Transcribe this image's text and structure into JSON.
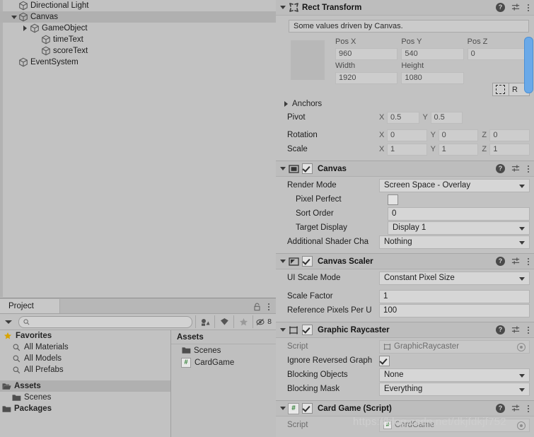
{
  "hierarchy": {
    "rows": [
      {
        "label": "Directional Light",
        "depth": 1,
        "twisty": "none",
        "selected": false
      },
      {
        "label": "Canvas",
        "depth": 1,
        "twisty": "down",
        "selected": true
      },
      {
        "label": "GameObject",
        "depth": 2,
        "twisty": "right",
        "selected": false
      },
      {
        "label": "timeText",
        "depth": 3,
        "twisty": "none",
        "selected": false
      },
      {
        "label": "scoreText",
        "depth": 3,
        "twisty": "none",
        "selected": false
      },
      {
        "label": "EventSystem",
        "depth": 1,
        "twisty": "none",
        "selected": false
      }
    ]
  },
  "project": {
    "tab_label": "Project",
    "search_value": "",
    "search_placeholder": "",
    "hidden_count": "8",
    "favorites_label": "Favorites",
    "favorites": [
      "All Materials",
      "All Models",
      "All Prefabs"
    ],
    "tree": [
      {
        "label": "Assets",
        "bold": true,
        "indent": 0,
        "selected": true,
        "icon": "folder-open-icon"
      },
      {
        "label": "Scenes",
        "bold": false,
        "indent": 1,
        "selected": false,
        "icon": "folder-icon"
      },
      {
        "label": "Packages",
        "bold": true,
        "indent": 0,
        "selected": false,
        "icon": "folder-icon"
      }
    ],
    "assets_header": "Assets",
    "assets": [
      {
        "label": "Scenes",
        "type": "folder"
      },
      {
        "label": "CardGame",
        "type": "script"
      }
    ]
  },
  "inspector": {
    "rect_transform": {
      "title": "Rect Transform",
      "notice": "Some values driven by Canvas.",
      "pos_x_label": "Pos X",
      "pos_y_label": "Pos Y",
      "pos_z_label": "Pos Z",
      "pos_x": "960",
      "pos_y": "540",
      "pos_z": "0",
      "width_label": "Width",
      "height_label": "Height",
      "width": "1920",
      "height": "1080",
      "anchor_preset_label": "R",
      "anchors_label": "Anchors",
      "pivot_label": "Pivot",
      "pivot_x": "0.5",
      "pivot_y": "0.5",
      "rotation_label": "Rotation",
      "rot_x": "0",
      "rot_y": "0",
      "rot_z": "0",
      "scale_label": "Scale",
      "scale_x": "1",
      "scale_y": "1",
      "scale_z": "1",
      "axis_x": "X",
      "axis_y": "Y",
      "axis_z": "Z"
    },
    "canvas": {
      "title": "Canvas",
      "enabled": true,
      "render_mode_label": "Render Mode",
      "render_mode_value": "Screen Space - Overlay",
      "pixel_perfect_label": "Pixel Perfect",
      "pixel_perfect_checked": false,
      "sort_order_label": "Sort Order",
      "sort_order_value": "0",
      "target_display_label": "Target Display",
      "target_display_value": "Display 1",
      "shader_channels_label": "Additional Shader Cha",
      "shader_channels_value": "Nothing"
    },
    "canvas_scaler": {
      "title": "Canvas Scaler",
      "enabled": true,
      "ui_scale_mode_label": "UI Scale Mode",
      "ui_scale_mode_value": "Constant Pixel Size",
      "scale_factor_label": "Scale Factor",
      "scale_factor_value": "1",
      "ref_pixels_label": "Reference Pixels Per U",
      "ref_pixels_value": "100"
    },
    "graphic_raycaster": {
      "title": "Graphic Raycaster",
      "enabled": true,
      "script_label": "Script",
      "script_value": "GraphicRaycaster",
      "ignore_reversed_label": "Ignore Reversed Graph",
      "ignore_reversed_checked": true,
      "blocking_objects_label": "Blocking Objects",
      "blocking_objects_value": "None",
      "blocking_mask_label": "Blocking Mask",
      "blocking_mask_value": "Everything"
    },
    "card_game": {
      "title": "Card Game (Script)",
      "enabled": true,
      "script_label": "Script",
      "script_value": "CardGame"
    }
  },
  "watermark": "https://blog.csdn.net/dkjfdkjf752",
  "colors": {
    "panel_bg": "#c2c2c2",
    "header_bg": "#bdbdbd",
    "selection": "#b0b0b0",
    "scrollbar": "#6aa9e8",
    "script_green": "#2e7d32",
    "favorite_star": "#d9a400"
  }
}
